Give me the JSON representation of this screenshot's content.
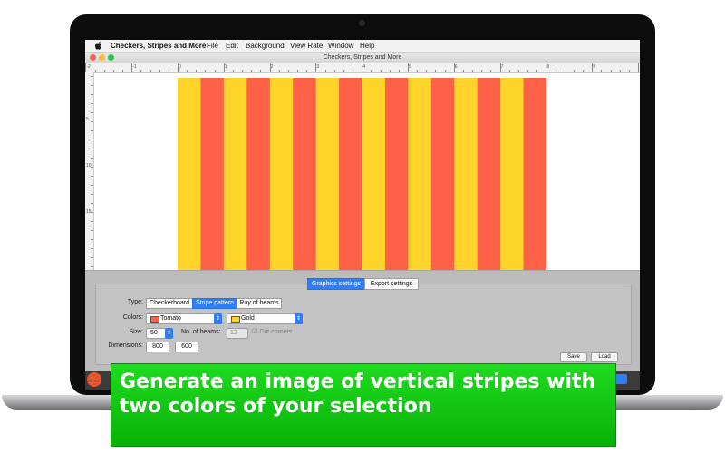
{
  "menubar": {
    "app_name": "Checkers, Stripes and More",
    "items": [
      "File",
      "Edit",
      "Background",
      "View Rate",
      "Window",
      "Help"
    ]
  },
  "window": {
    "title": "Checkers, Stripes and More"
  },
  "ruler": {
    "top_labels": [
      "-2",
      "-1",
      "0",
      "1",
      "2",
      "3",
      "4",
      "5",
      "6",
      "7",
      "8",
      "9"
    ],
    "left_labels": [
      "5",
      "10",
      "15"
    ]
  },
  "canvas": {
    "stripe_count": 16,
    "colors": {
      "primary": "#ffd42a",
      "secondary": "#fd6249"
    }
  },
  "panel": {
    "tabs": [
      "Graphics settings",
      "Export settings"
    ],
    "type_label": "Type:",
    "type_options": [
      "Checkerboard",
      "Stripe pattern",
      "Ray of beams"
    ],
    "colors_label": "Colors:",
    "color1_name": "Tomato",
    "color2_name": "Gold",
    "size_label": "Size:",
    "size_value": "50",
    "beams_label": "No. of beams:",
    "beams_value": "12",
    "cut_corners_label": "Cut corners",
    "dimensions_label": "Dimensions:",
    "width_value": "800",
    "height_value": "600",
    "save_label": "Save",
    "load_label": "Load"
  },
  "caption": {
    "line1": "Generate an image of vertical stripes with",
    "line2": "two colors of your selection"
  },
  "accent": "#2f7ef7",
  "banner_color": "#12c512"
}
